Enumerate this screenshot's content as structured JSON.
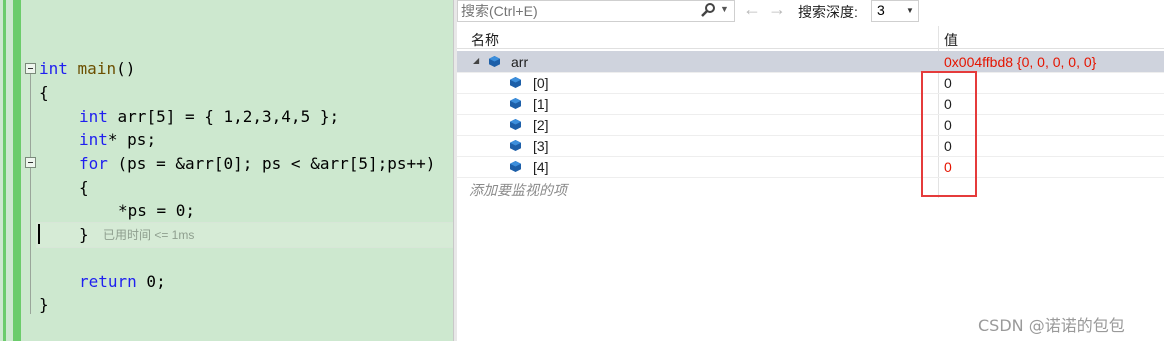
{
  "editor": {
    "lines": {
      "l1": {
        "kw": "int",
        "fn": "main",
        "rest": "()"
      },
      "l2": "{",
      "l3": {
        "kw": "int",
        "rest": " arr[5] = { 1,2,3,4,5 };"
      },
      "l4": {
        "kw": "int",
        "rest": "* ps;"
      },
      "l5": {
        "kw": "for",
        "rest": " (ps = &arr[0]; ps < &arr[5];ps++)"
      },
      "l6": "{",
      "l7": "*ps = 0;",
      "l8": "}",
      "l9": {
        "kw": "return",
        "rest": " 0;"
      },
      "l10": "}"
    },
    "perf_tip": "已用时间 <= 1ms"
  },
  "watch": {
    "search_placeholder": "搜索(Ctrl+E)",
    "search_icon": "search-icon",
    "back_arrow": "←",
    "forward_arrow": "→",
    "depth_label": "搜索深度:",
    "depth_value": "3",
    "col_name": "名称",
    "col_value": "值",
    "rows": [
      {
        "name": "arr",
        "value": "0x004ffbd8 {0, 0, 0, 0, 0}",
        "changed": true
      },
      {
        "name": "[0]",
        "value": "0",
        "changed": false
      },
      {
        "name": "[1]",
        "value": "0",
        "changed": false
      },
      {
        "name": "[2]",
        "value": "0",
        "changed": false
      },
      {
        "name": "[3]",
        "value": "0",
        "changed": false
      },
      {
        "name": "[4]",
        "value": "0",
        "changed": true
      }
    ],
    "add_watch": "添加要监视的项"
  },
  "watermark": "CSDN @诺诺的包包",
  "colors": {
    "changed_value": "#e51400",
    "keyword": "#1f1ff0",
    "highlight_box": "#e53b3b"
  }
}
